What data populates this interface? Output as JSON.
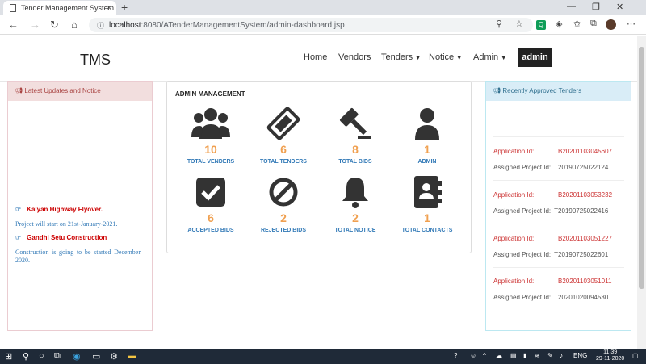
{
  "browser": {
    "tab_title": "Tender Management System",
    "url_host": "localhost",
    "url_path": ":8080/ATenderManagementSystem/admin-dashboard.jsp"
  },
  "nav": {
    "brand": "TMS",
    "home": "Home",
    "vendors": "Vendors",
    "tenders": "Tenders",
    "notice": "Notice",
    "admin_menu": "Admin",
    "admin_button": "admin"
  },
  "left_panel": {
    "title": "Latest Updates and Notice",
    "notices": [
      {
        "title": "Kalyan Highway Flyover.",
        "body": "Project will start on 21st-January-2021."
      },
      {
        "title": "Gandhi Setu Construction",
        "body": "Construction is going to be started December 2020."
      }
    ]
  },
  "admin_management": {
    "title": "ADMIN MANAGEMENT",
    "stats": [
      {
        "icon": "users-icon",
        "value": "10",
        "label": "TOTAL VENDERS"
      },
      {
        "icon": "ticket-icon",
        "value": "6",
        "label": "TOTAL TENDERS"
      },
      {
        "icon": "gavel-icon",
        "value": "8",
        "label": "TOTAL BIDS"
      },
      {
        "icon": "user-icon",
        "value": "1",
        "label": "ADMIN"
      },
      {
        "icon": "check-square-icon",
        "value": "6",
        "label": "ACCEPTED BIDS"
      },
      {
        "icon": "ban-icon",
        "value": "2",
        "label": "REJECTED BIDS"
      },
      {
        "icon": "bell-icon",
        "value": "2",
        "label": "TOTAL NOTICE"
      },
      {
        "icon": "address-book-icon",
        "value": "1",
        "label": "TOTAL CONTACTS"
      }
    ]
  },
  "right_panel": {
    "title": "Recently Approved Tenders",
    "app_label": "Application Id:",
    "proj_label": "Assigned Project Id:",
    "items": [
      {
        "app_id": "B20201103045607",
        "project_id": "T20190725022124"
      },
      {
        "app_id": "B20201103053232",
        "project_id": "T20190725022416"
      },
      {
        "app_id": "B20201103051227",
        "project_id": "T20190725022601"
      },
      {
        "app_id": "B20201103051011",
        "project_id": "T20201020094530"
      }
    ]
  },
  "taskbar": {
    "lang": "ENG",
    "time": "11:39",
    "date": "29-11-2020"
  },
  "colors": {
    "accent_orange": "#f0a050",
    "link_blue": "#337ab7",
    "danger_red": "#cc3333"
  }
}
